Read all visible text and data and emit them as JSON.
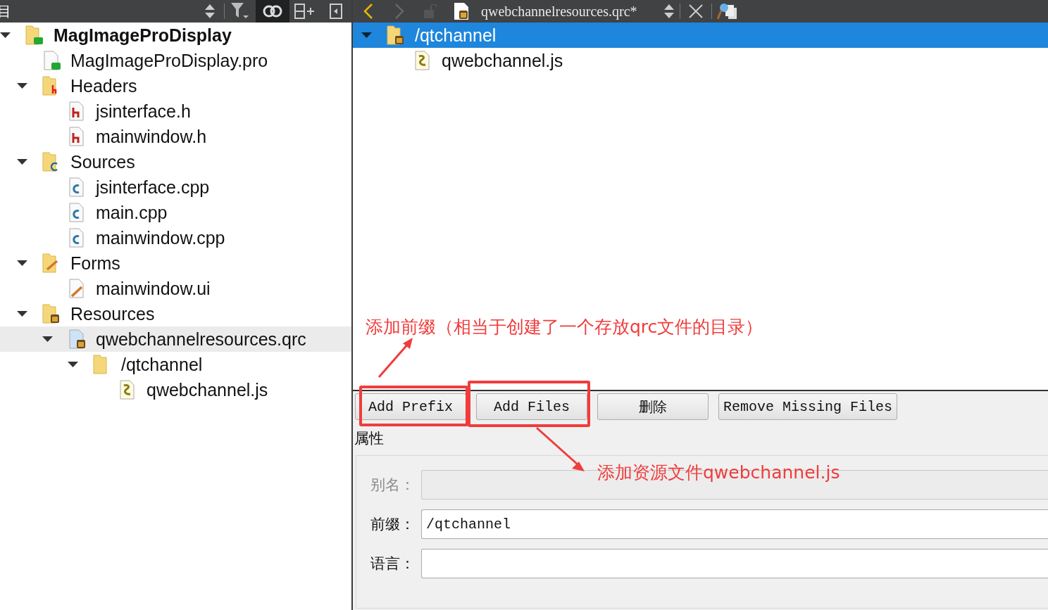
{
  "left_toolbar": {
    "title": "目"
  },
  "project_tree": [
    {
      "label": "MagImageProDisplay",
      "kind": "folder-qt",
      "expanded": true,
      "selected": false,
      "children": [
        {
          "label": "MagImageProDisplay.pro",
          "kind": "file-qt",
          "selected": false
        },
        {
          "label": "Headers",
          "kind": "folder-h",
          "expanded": true,
          "selected": false,
          "children": [
            {
              "label": "jsinterface.h",
              "kind": "file-h",
              "selected": false
            },
            {
              "label": "mainwindow.h",
              "kind": "file-h",
              "selected": false
            }
          ]
        },
        {
          "label": "Sources",
          "kind": "folder-cpp",
          "expanded": true,
          "selected": false,
          "children": [
            {
              "label": "jsinterface.cpp",
              "kind": "file-cpp",
              "selected": false
            },
            {
              "label": "main.cpp",
              "kind": "file-cpp",
              "selected": false
            },
            {
              "label": "mainwindow.cpp",
              "kind": "file-cpp",
              "selected": false
            }
          ]
        },
        {
          "label": "Forms",
          "kind": "folder-ui",
          "expanded": true,
          "selected": false,
          "children": [
            {
              "label": "mainwindow.ui",
              "kind": "file-ui",
              "selected": false
            }
          ]
        },
        {
          "label": "Resources",
          "kind": "folder-res",
          "expanded": true,
          "selected": false,
          "children": [
            {
              "label": "qwebchannelresources.qrc",
              "kind": "file-qrc",
              "expanded": true,
              "selected": true,
              "children": [
                {
                  "label": "/qtchannel",
                  "kind": "folder",
                  "expanded": true,
                  "selected": false,
                  "children": [
                    {
                      "label": "qwebchannel.js",
                      "kind": "file-js",
                      "selected": false
                    }
                  ]
                }
              ]
            }
          ]
        }
      ]
    }
  ],
  "editor_toolbar": {
    "file_name": "qwebchannelresources.qrc*"
  },
  "resource_tree": [
    {
      "label": "/qtchannel",
      "kind": "folder-res",
      "expanded": true,
      "selected": true,
      "children": [
        {
          "label": "qwebchannel.js",
          "kind": "file-js",
          "selected": false
        }
      ]
    }
  ],
  "buttons": [
    {
      "label": "Add Prefix",
      "highlighted": true
    },
    {
      "label": "Add Files",
      "highlighted": true
    },
    {
      "label": "删除",
      "highlighted": false
    },
    {
      "label": "Remove Missing Files",
      "highlighted": false
    }
  ],
  "properties": {
    "title": "属性",
    "fields": [
      {
        "label": "别名：",
        "disabled": true
      },
      {
        "label": "前缀：",
        "value": "/qtchannel",
        "disabled": false
      },
      {
        "label": "语言：",
        "disabled": false
      }
    ]
  },
  "annotations": [
    {
      "text": "添加前缀（相当于创建了一个存放qrc文件的目录）"
    },
    {
      "text": "添加资源文件qwebchannel.js"
    }
  ]
}
